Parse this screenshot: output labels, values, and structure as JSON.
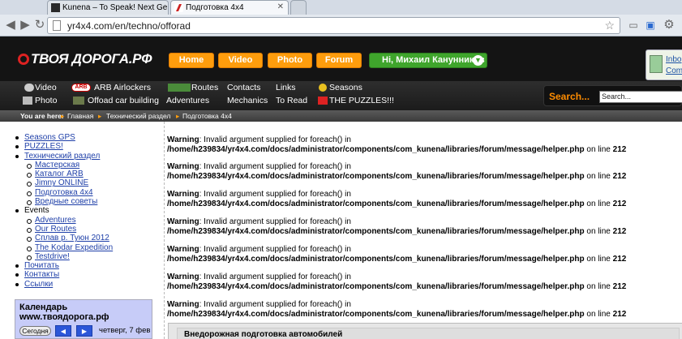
{
  "browser": {
    "tabs": [
      {
        "title": "Kunena – To Speak! Next Ge",
        "active": false
      },
      {
        "title": "Подготовка 4x4",
        "active": true
      }
    ],
    "url": "yr4x4.com/en/techno/offorad"
  },
  "site": {
    "logo": "ТВОЯ ДОРОГА.РФ",
    "top_buttons": [
      "Home",
      "Video",
      "Photo",
      "Forum"
    ],
    "user_button": "Hi, Михаил Канунников",
    "inbox_links": [
      "Inbo",
      "Com"
    ],
    "nav": {
      "col1": [
        "Video",
        "Photo"
      ],
      "col2": [
        "ARB Airlockers",
        "Offoad car building"
      ],
      "col3": [
        "Routes",
        "Adventures"
      ],
      "col4": [
        "Contacts",
        "Mechanics"
      ],
      "col5": [
        "Links",
        "To Read"
      ],
      "col6": [
        "Seasons",
        "THE PUZZLES!!!"
      ]
    },
    "search": {
      "label": "Search...",
      "placeholder": "Search..."
    },
    "breadcrumb": {
      "prefix": "You are here:",
      "items": [
        "Главная",
        "Технический раздел",
        "Подготовка 4x4"
      ]
    }
  },
  "sidebar": {
    "items": [
      {
        "label": "Seasons GPS",
        "link": true,
        "level": 1
      },
      {
        "label": "PUZZLES!",
        "link": true,
        "level": 1
      },
      {
        "label": "Технический раздел",
        "link": true,
        "level": 1
      },
      {
        "label": "Мастерская",
        "link": true,
        "level": 2
      },
      {
        "label": "Каталог ARB",
        "link": true,
        "level": 2
      },
      {
        "label": "Jimny ONLINE",
        "link": true,
        "level": 2
      },
      {
        "label": "Подготовка 4x4",
        "link": true,
        "level": 2
      },
      {
        "label": "Вредные советы",
        "link": true,
        "level": 2
      },
      {
        "label": "Events",
        "link": false,
        "level": 1
      },
      {
        "label": "Adventures",
        "link": true,
        "level": 2
      },
      {
        "label": "Our Routes",
        "link": true,
        "level": 2
      },
      {
        "label": "Сплав р. Туюн 2012",
        "link": true,
        "level": 2
      },
      {
        "label": "The Kodar Expedition",
        "link": true,
        "level": 2
      },
      {
        "label": "Testdrive!",
        "link": true,
        "level": 2
      },
      {
        "label": "Почитать",
        "link": true,
        "level": 1
      },
      {
        "label": "Контакты",
        "link": true,
        "level": 1
      },
      {
        "label": "Ссылки",
        "link": true,
        "level": 1
      }
    ],
    "calendar": {
      "title": "Календарь",
      "subtitle": "www.твоядорога.рф",
      "today": "Сегодня",
      "prev": "◀",
      "next": "▶",
      "date": "четверг, 7 фев"
    }
  },
  "main": {
    "warnings": [
      {
        "label": "Warning",
        "message": ": Invalid argument supplied for foreach() in",
        "path": "/home/h239834/yr4x4.com/docs/administrator/components/com_kunena/libraries/forum/message/helper.php",
        "online": " on line ",
        "line": "212"
      },
      {
        "label": "Warning",
        "message": ": Invalid argument supplied for foreach() in",
        "path": "/home/h239834/yr4x4.com/docs/administrator/components/com_kunena/libraries/forum/message/helper.php",
        "online": " on line ",
        "line": "212"
      },
      {
        "label": "Warning",
        "message": ": Invalid argument supplied for foreach() in",
        "path": "/home/h239834/yr4x4.com/docs/administrator/components/com_kunena/libraries/forum/message/helper.php",
        "online": " on line ",
        "line": "212"
      },
      {
        "label": "Warning",
        "message": ": Invalid argument supplied for foreach() in",
        "path": "/home/h239834/yr4x4.com/docs/administrator/components/com_kunena/libraries/forum/message/helper.php",
        "online": " on line ",
        "line": "212"
      },
      {
        "label": "Warning",
        "message": ": Invalid argument supplied for foreach() in",
        "path": "/home/h239834/yr4x4.com/docs/administrator/components/com_kunena/libraries/forum/message/helper.php",
        "online": " on line ",
        "line": "212"
      },
      {
        "label": "Warning",
        "message": ": Invalid argument supplied for foreach() in",
        "path": "/home/h239834/yr4x4.com/docs/administrator/components/com_kunena/libraries/forum/message/helper.php",
        "online": " on line ",
        "line": "212"
      },
      {
        "label": "Warning",
        "message": ": Invalid argument supplied for foreach() in",
        "path": "/home/h239834/yr4x4.com/docs/administrator/components/com_kunena/libraries/forum/message/helper.php",
        "online": " on line ",
        "line": "212"
      }
    ],
    "article_title": "Внедорожная подготовка автомобилей"
  },
  "colors": {
    "orange": "#ff9d0d",
    "green": "#3fa52c",
    "link": "#1e3fa8"
  }
}
